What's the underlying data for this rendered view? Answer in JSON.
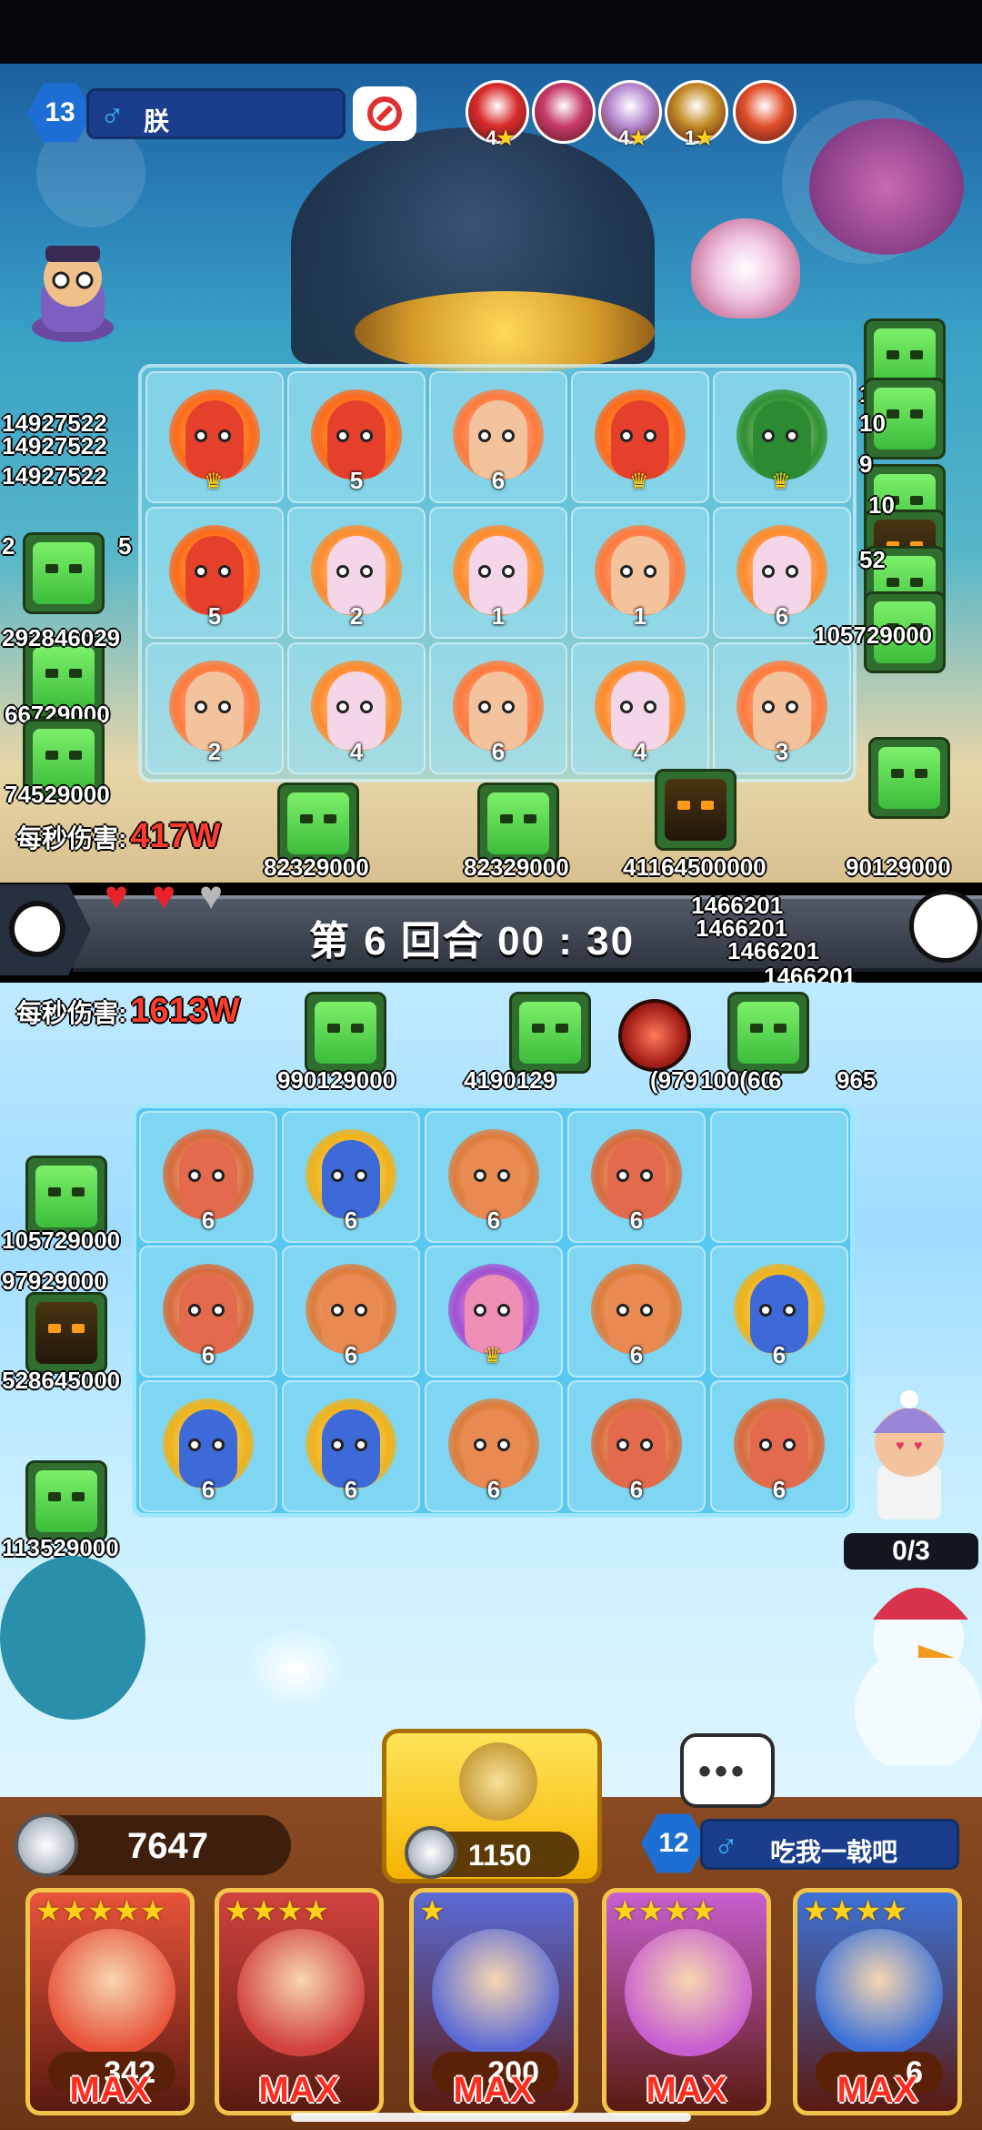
{
  "opponent": {
    "level": "13",
    "gender_symbol": "♂",
    "name": "朕",
    "team": [
      {
        "stars": "4",
        "color": "#d92b2b"
      },
      {
        "stars": "",
        "color": "#c73a6a"
      },
      {
        "stars": "4",
        "color": "#b68bd0"
      },
      {
        "stars": "1",
        "color": "#c38b25"
      },
      {
        "stars": "",
        "color": "#e24f2a"
      }
    ],
    "dps_label": "每秒伤害:",
    "dps_value": "417W",
    "board": [
      [
        {
          "lvl": "",
          "crown": true,
          "kind": "fire"
        },
        {
          "lvl": "5",
          "kind": "fire"
        },
        {
          "lvl": "6",
          "kind": "girl"
        },
        {
          "lvl": "",
          "crown": true,
          "kind": "fire"
        },
        {
          "lvl": "",
          "crown": true,
          "kind": "tree"
        }
      ],
      [
        {
          "lvl": "5",
          "kind": "fire"
        },
        {
          "lvl": "2",
          "kind": "angel"
        },
        {
          "lvl": "1",
          "kind": "angel"
        },
        {
          "lvl": "1",
          "kind": "girl"
        },
        {
          "lvl": "6",
          "kind": "angel"
        }
      ],
      [
        {
          "lvl": "2",
          "kind": "girl"
        },
        {
          "lvl": "4",
          "kind": "angel"
        },
        {
          "lvl": "6",
          "kind": "girl"
        },
        {
          "lvl": "4",
          "kind": "angel"
        },
        {
          "lvl": "3",
          "kind": "girl"
        }
      ]
    ],
    "enemy_hp": [
      "14927522",
      "14927522",
      "14927522",
      "2",
      "5",
      "292846029",
      "66729000",
      "74529000",
      "82329000",
      "82329000",
      "41164500000",
      "90129000",
      "105729000",
      "11",
      "10",
      "9",
      "10",
      "52",
      "9"
    ]
  },
  "round": {
    "label": "第 6 回合 00 : 30"
  },
  "lives": {
    "full": 2,
    "empty": 1
  },
  "damage_float": [
    "1466201",
    "1466201",
    "1466201",
    "1466201",
    "1466201"
  ],
  "me": {
    "dps_label": "每秒伤害:",
    "dps_value": "1613W",
    "board": [
      [
        {
          "lvl": "6",
          "kind": "clock"
        },
        {
          "lvl": "6",
          "kind": "gold"
        },
        {
          "lvl": "6",
          "kind": "boxer"
        },
        {
          "lvl": "6",
          "kind": "clock"
        },
        {
          "lvl": "",
          "kind": "empty"
        }
      ],
      [
        {
          "lvl": "6",
          "kind": "clock"
        },
        {
          "lvl": "6",
          "kind": "boxer"
        },
        {
          "lvl": "",
          "crown": true,
          "kind": "hula"
        },
        {
          "lvl": "6",
          "kind": "boxer"
        },
        {
          "lvl": "6",
          "kind": "gold"
        }
      ],
      [
        {
          "lvl": "6",
          "kind": "gold"
        },
        {
          "lvl": "6",
          "kind": "gold"
        },
        {
          "lvl": "6",
          "kind": "boxer"
        },
        {
          "lvl": "6",
          "kind": "clock"
        },
        {
          "lvl": "6",
          "kind": "clock"
        }
      ]
    ],
    "enemy_hp": [
      "990129000",
      "4190129",
      "(979",
      "100(60",
      "6",
      "965",
      "105729000",
      "97929000",
      "528645000",
      "113529000"
    ],
    "counter": "0/3",
    "coins": "7647",
    "summon_cost": "1150",
    "level": "12",
    "gender_symbol": "♂",
    "name": "吃我一戟吧",
    "cards": [
      {
        "stars": "★★★★★",
        "badge": "342",
        "max": "MAX",
        "color": "#e8533a"
      },
      {
        "stars": "★★★★",
        "badge": "",
        "max": "MAX",
        "color": "#d2423f"
      },
      {
        "stars": "★",
        "badge": "200",
        "max": "MAX",
        "color": "#5a6ad6"
      },
      {
        "stars": "★★★★",
        "badge": "",
        "max": "MAX",
        "color": "#c85fd0"
      },
      {
        "stars": "★★★★",
        "badge": "6",
        "max": "MAX",
        "color": "#3d72d8"
      }
    ]
  },
  "icons": {
    "block": "no-entry-icon",
    "skill": "clover-icon",
    "panda": "panda-icon",
    "chat": "chat-icon",
    "coin": "crown-coin-icon",
    "heart": "heart-icon"
  }
}
